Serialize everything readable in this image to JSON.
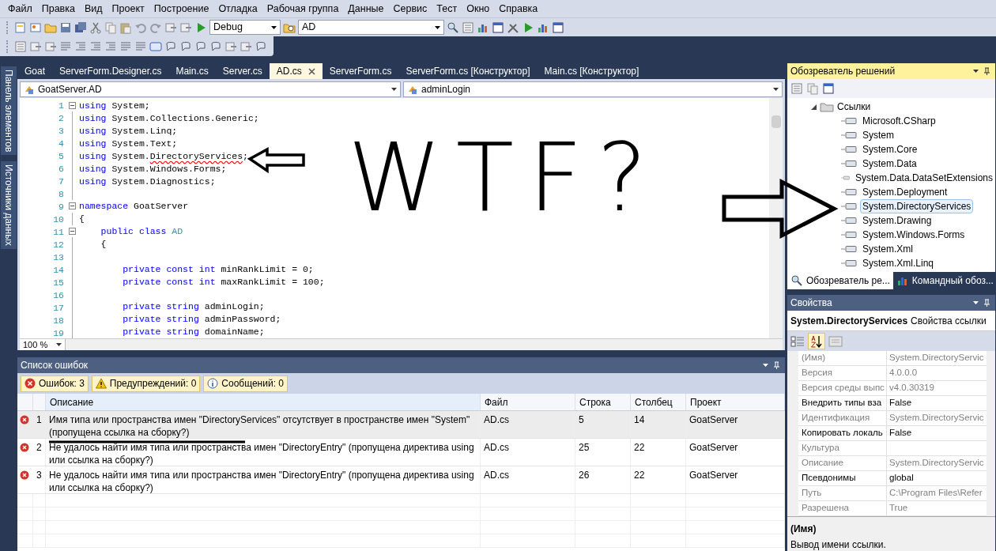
{
  "menu": [
    "Файл",
    "Правка",
    "Вид",
    "Проект",
    "Построение",
    "Отладка",
    "Рабочая группа",
    "Данные",
    "Сервис",
    "Тест",
    "Окно",
    "Справка"
  ],
  "toolbar": {
    "configuration": "Debug",
    "find_box": "AD"
  },
  "side_tabs": [
    "Панель элементов",
    "Источники данных"
  ],
  "doc_tabs": [
    {
      "label": "Goat",
      "selected": false
    },
    {
      "label": "ServerForm.Designer.cs",
      "selected": false
    },
    {
      "label": "Main.cs",
      "selected": false
    },
    {
      "label": "Server.cs",
      "selected": false
    },
    {
      "label": "AD.cs",
      "selected": true
    },
    {
      "label": "ServerForm.cs",
      "selected": false
    },
    {
      "label": "ServerForm.cs [Конструктор]",
      "selected": false
    },
    {
      "label": "Main.cs [Конструктор]",
      "selected": false
    }
  ],
  "nav": {
    "type": "GoatServer.AD",
    "member": "adminLogin"
  },
  "code": {
    "lines": [
      {
        "number": "1",
        "fold": true,
        "tokens": [
          {
            "text": "using",
            "kind": "keyword"
          },
          {
            "text": " System;",
            "kind": "plain"
          }
        ]
      },
      {
        "number": "2",
        "fold": false,
        "tokens": [
          {
            "text": "using",
            "kind": "keyword"
          },
          {
            "text": " System.Collections.Generic;",
            "kind": "plain"
          }
        ]
      },
      {
        "number": "3",
        "fold": false,
        "tokens": [
          {
            "text": "using",
            "kind": "keyword"
          },
          {
            "text": " System.Linq;",
            "kind": "plain"
          }
        ]
      },
      {
        "number": "4",
        "fold": false,
        "tokens": [
          {
            "text": "using",
            "kind": "keyword"
          },
          {
            "text": " System.Text;",
            "kind": "plain"
          }
        ]
      },
      {
        "number": "5",
        "fold": false,
        "tokens": [
          {
            "text": "using",
            "kind": "keyword"
          },
          {
            "text": " System.",
            "kind": "plain"
          },
          {
            "text": "DirectoryServices",
            "kind": "error"
          },
          {
            "text": ";",
            "kind": "plain"
          }
        ]
      },
      {
        "number": "6",
        "fold": false,
        "tokens": [
          {
            "text": "using",
            "kind": "keyword"
          },
          {
            "text": " System.Windows.Forms;",
            "kind": "plain"
          }
        ]
      },
      {
        "number": "7",
        "fold": false,
        "tokens": [
          {
            "text": "using",
            "kind": "keyword"
          },
          {
            "text": " System.Diagnostics;",
            "kind": "plain"
          }
        ]
      },
      {
        "number": "8",
        "fold": false
      },
      {
        "number": "9",
        "fold": true,
        "tokens": [
          {
            "text": "namespace",
            "kind": "keyword"
          },
          {
            "text": " GoatServer",
            "kind": "plain"
          }
        ]
      },
      {
        "number": "10",
        "fold": false,
        "tokens": [
          {
            "text": "{",
            "kind": "plain"
          }
        ]
      },
      {
        "number": "11",
        "fold": true,
        "tokens": [
          {
            "text": "    public class",
            "kind": "keyword"
          },
          {
            "text": " AD",
            "kind": "type"
          }
        ]
      },
      {
        "number": "12",
        "fold": false,
        "tokens": [
          {
            "text": "    {",
            "kind": "plain"
          }
        ]
      },
      {
        "number": "13",
        "fold": false
      },
      {
        "number": "14",
        "fold": false,
        "tokens": [
          {
            "text": "        private const int",
            "kind": "keyword"
          },
          {
            "text": " minRankLimit = 0;",
            "kind": "plain"
          }
        ]
      },
      {
        "number": "15",
        "fold": false,
        "tokens": [
          {
            "text": "        private const int",
            "kind": "keyword"
          },
          {
            "text": " maxRankLimit = 100;",
            "kind": "plain"
          }
        ]
      },
      {
        "number": "16",
        "fold": false
      },
      {
        "number": "17",
        "fold": false,
        "tokens": [
          {
            "text": "        private string",
            "kind": "keyword"
          },
          {
            "text": " adminLogin;",
            "kind": "plain"
          }
        ]
      },
      {
        "number": "18",
        "fold": false,
        "tokens": [
          {
            "text": "        private string",
            "kind": "keyword"
          },
          {
            "text": " adminPassword;",
            "kind": "plain"
          }
        ]
      },
      {
        "number": "19",
        "fold": false,
        "tokens": [
          {
            "text": "        private string",
            "kind": "keyword"
          },
          {
            "text": " domainName;",
            "kind": "plain"
          }
        ]
      }
    ]
  },
  "zoom": "100 %",
  "error_list": {
    "title": "Список ошибок",
    "filters": [
      {
        "label": "Ошибок: 3",
        "kind": "error"
      },
      {
        "label": "Предупреждений: 0",
        "kind": "warning"
      },
      {
        "label": "Сообщений: 0",
        "kind": "info"
      }
    ],
    "columns": [
      "Описание",
      "Файл",
      "Строка",
      "Столбец",
      "Проект"
    ],
    "rows": [
      {
        "number": "1",
        "description": "Имя типа или пространства имен \"DirectoryServices\" отсутствует в пространстве имен \"System\" (пропущена ссылка на сборку?)",
        "file": "AD.cs",
        "line": "5",
        "column": "14",
        "project": "GoatServer",
        "selected": true
      },
      {
        "number": "2",
        "description": "Не удалось найти имя типа или пространства имен \"DirectoryEntry\" (пропущена директива using или ссылка на сборку?)",
        "file": "AD.cs",
        "line": "25",
        "column": "22",
        "project": "GoatServer",
        "selected": false
      },
      {
        "number": "3",
        "description": "Не удалось найти имя типа или пространства имен \"DirectoryEntry\" (пропущена директива using или ссылка на сборку?)",
        "file": "AD.cs",
        "line": "26",
        "column": "22",
        "project": "GoatServer",
        "selected": false
      }
    ]
  },
  "solution_explorer": {
    "title": "Обозреватель решений",
    "tree": [
      {
        "label": "Ссылки",
        "expanded": true,
        "children": [
          {
            "label": "Microsoft.CSharp",
            "selected": false
          },
          {
            "label": "System",
            "selected": false
          },
          {
            "label": "System.Core",
            "selected": false
          },
          {
            "label": "System.Data",
            "selected": false
          },
          {
            "label": "System.Data.DataSetExtensions",
            "selected": false
          },
          {
            "label": "System.Deployment",
            "selected": false
          },
          {
            "label": "System.DirectoryServices",
            "selected": true
          },
          {
            "label": "System.Drawing",
            "selected": false
          },
          {
            "label": "System.Windows.Forms",
            "selected": false
          },
          {
            "label": "System.Xml",
            "selected": false
          },
          {
            "label": "System.Xml.Linq",
            "selected": false
          }
        ]
      }
    ],
    "tabs": [
      {
        "label": "Обозреватель ре...",
        "selected": true
      },
      {
        "label": "Командный обоз...",
        "selected": false
      }
    ]
  },
  "properties": {
    "title": "Свойства",
    "object": "System.DirectoryServices",
    "object_type": "Свойства ссылки",
    "rows": [
      {
        "name": "(Имя)",
        "value": "System.DirectoryServic",
        "readonly": true
      },
      {
        "name": "Версия",
        "value": "4.0.0.0",
        "readonly": true
      },
      {
        "name": "Версия среды выпс",
        "value": "v4.0.30319",
        "readonly": true
      },
      {
        "name": "Внедрить типы вза",
        "value": "False",
        "readonly": false
      },
      {
        "name": "Идентификация",
        "value": "System.DirectoryServic",
        "readonly": true
      },
      {
        "name": "Копировать локаль",
        "value": "False",
        "readonly": false
      },
      {
        "name": "Культура",
        "readonly": true
      },
      {
        "name": "Описание",
        "value": "System.DirectoryServic",
        "readonly": true
      },
      {
        "name": "Псевдонимы",
        "value": "global",
        "readonly": false
      },
      {
        "name": "Путь",
        "value": "C:\\Program Files\\Refer",
        "readonly": true
      },
      {
        "name": "Разрешена",
        "value": "True",
        "readonly": true
      }
    ],
    "description_title": "(Имя)",
    "description": "Вывод имени ссылки."
  },
  "annotation": {
    "text": "WTF?"
  }
}
